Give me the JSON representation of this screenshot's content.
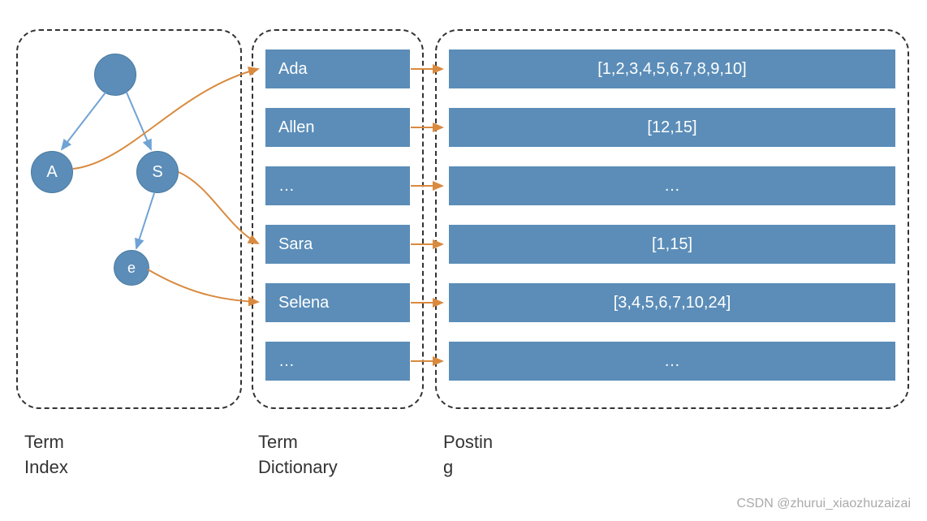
{
  "labels": {
    "termIndex": "Term\nIndex",
    "termDict": "Term\nDictionary",
    "posting": "Postin\ng"
  },
  "nodes": {
    "root": "",
    "a": "A",
    "s": "S",
    "e": "e"
  },
  "dict": [
    "Ada",
    "Allen",
    "…",
    "Sara",
    "Selena",
    "…"
  ],
  "posting": [
    "[1,2,3,4,5,6,7,8,9,10]",
    "[12,15]",
    "…",
    "[1,15]",
    "[3,4,5,6,7,10,24]",
    "…"
  ],
  "watermark": "CSDN @zhurui_xiaozhuzaizai"
}
